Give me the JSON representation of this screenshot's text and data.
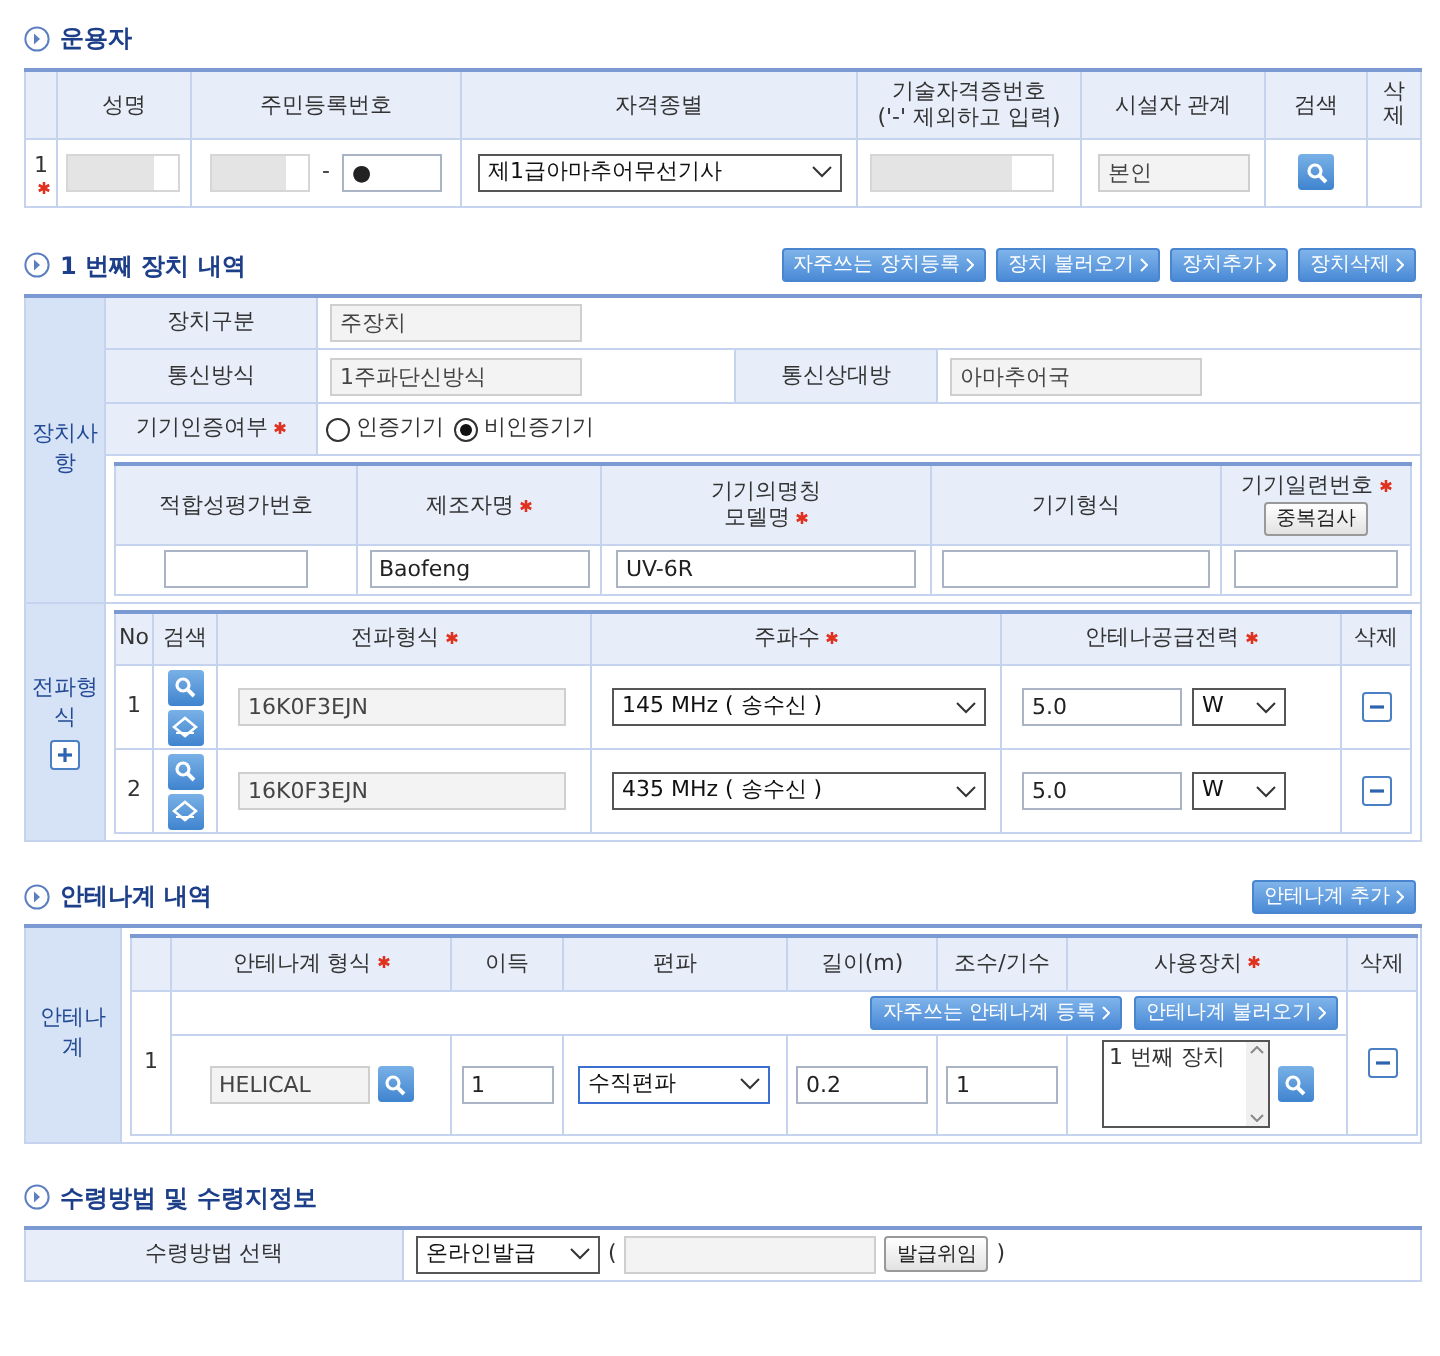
{
  "operator": {
    "title": "운용자",
    "columns": [
      {
        "label": "성명"
      },
      {
        "label": "주민등록번호"
      },
      {
        "label": "자격종별"
      },
      {
        "label": "기술자격증번호",
        "sub": "('-' 제외하고 입력)"
      },
      {
        "label": "시설자 관계"
      },
      {
        "label": "검색"
      },
      {
        "label": "삭제"
      }
    ],
    "rows": [
      {
        "no": "1",
        "required": true,
        "id_separator": "-",
        "id_back": "●",
        "license_type": "제1급아마추어무선기사",
        "relation": "본인"
      }
    ]
  },
  "device": {
    "title": "1 번째 장치 내역",
    "buttons": [
      "자주쓰는 장치등록",
      "장치 불러오기",
      "장치추가",
      "장치삭제"
    ],
    "side_label": "장치사항",
    "fields": [
      {
        "label": "장치구분",
        "value": "주장치"
      },
      {
        "label": "통신방식",
        "value": "1주파단신방식"
      },
      {
        "label": "통신상대방",
        "value": "아마추어국"
      }
    ],
    "certification": {
      "label": "기기인증여부",
      "required": true,
      "options": [
        {
          "label": "인증기기",
          "selected": false
        },
        {
          "label": "비인증기기",
          "selected": true
        }
      ]
    },
    "equipment_columns": [
      {
        "label": "적합성평가번호",
        "required": false
      },
      {
        "label": "제조자명",
        "required": true,
        "value": "Baofeng"
      },
      {
        "label": "기기의명칭",
        "sub": "모델명",
        "required": true,
        "value": "UV-6R"
      },
      {
        "label": "기기형식",
        "required": false
      },
      {
        "label": "기기일련번호",
        "required": true,
        "button": "중복검사"
      }
    ],
    "emission_label": "전파형식",
    "emission_columns": [
      {
        "label": "No",
        "required": false
      },
      {
        "label": "검색",
        "required": false
      },
      {
        "label": "전파형식",
        "required": true
      },
      {
        "label": "주파수",
        "required": true
      },
      {
        "label": "안테나공급전력",
        "required": true
      },
      {
        "label": "삭제",
        "required": false
      }
    ],
    "emissions": [
      {
        "no": "1",
        "emission": "16K0F3EJN",
        "frequency": "145 MHz ( 송수신 )",
        "power": "5.0",
        "unit": "W"
      },
      {
        "no": "2",
        "emission": "16K0F3EJN",
        "frequency": "435 MHz ( 송수신 )",
        "power": "5.0",
        "unit": "W"
      }
    ]
  },
  "antenna": {
    "title": "안테나계 내역",
    "add_button": "안테나계 추가",
    "side_label": "안테나계",
    "columns": [
      {
        "label": "안테나계 형식",
        "required": true
      },
      {
        "label": "이득",
        "required": false
      },
      {
        "label": "편파",
        "required": false
      },
      {
        "label": "길이(m)",
        "required": false
      },
      {
        "label": "조수/기수",
        "required": false
      },
      {
        "label": "사용장치",
        "required": true
      },
      {
        "label": "삭제",
        "required": false
      }
    ],
    "buttons": [
      "자주쓰는 안테나계 등록",
      "안테나계 불러오기"
    ],
    "rows": [
      {
        "no": "1",
        "type": "HELICAL",
        "gain": "1",
        "polarization": "수직편파",
        "length": "0.2",
        "count": "1",
        "devices": "1 번째 장치"
      }
    ]
  },
  "receipt": {
    "title": "수령방법 및 수령지정보",
    "label": "수령방법 선택",
    "method": "온라인발급",
    "open_paren": "(",
    "button": "발급위임",
    "close_paren": ")"
  }
}
